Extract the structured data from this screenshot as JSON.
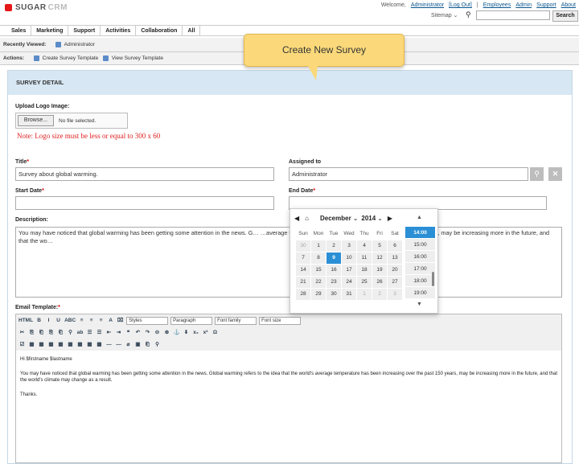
{
  "header": {
    "logo_main": "SUGAR",
    "logo_suffix": "CRM",
    "welcome": "Welcome,",
    "user": "Administrator",
    "logout": "[Log Out]",
    "links": [
      "Employees",
      "Admin",
      "Support",
      "About"
    ],
    "sitemap": "Sitemap ⌄",
    "search_button": "Search"
  },
  "nav": {
    "tabs": [
      "Sales",
      "Marketing",
      "Support",
      "Activities",
      "Collaboration",
      "All"
    ]
  },
  "recent": {
    "label": "Recently Viewed:",
    "item": "Administrator"
  },
  "actions": {
    "label": "Actions:",
    "items": [
      "Create Survey Template",
      "View Survey Template"
    ]
  },
  "tooltip": {
    "text": "Create New Survey"
  },
  "form": {
    "panel_title": "SURVEY DETAIL",
    "upload_label": "Upload Logo Image:",
    "browse": "Browse...",
    "no_file": "No file selected.",
    "note": "Note: Logo size must be less or equal to 300 x 60",
    "title_label": "Title",
    "title_value": "Survey about global warming.",
    "assigned_label": "Assigned to",
    "assigned_value": "Administrator",
    "start_label": "Start Date",
    "end_label": "End Date",
    "desc_label": "Description:",
    "desc_value": "You may have noticed that global warming has been getting some attention in the news. G… …average temperature has been increasing over the past 150 years, may be increasing more in the future, and that the wo…",
    "email_label": "Email Template:"
  },
  "editor": {
    "row1": [
      "HTML",
      "B",
      "I",
      "U",
      "ABC",
      "≡",
      "≡",
      "≡",
      "A",
      "⌧"
    ],
    "styles": "Styles",
    "paragraph": "Paragraph",
    "font_family": "Font family",
    "font_size": "Font size",
    "row2": [
      "✂",
      "⎘",
      "⎗",
      "⎘",
      "⎗",
      "⚲",
      "ab",
      "☰",
      "☰",
      "⇤",
      "⇥",
      "❝",
      "↶",
      "↷",
      "⊝",
      "⊕",
      "⚓",
      "⬇",
      "x₂",
      "x²",
      "Ω"
    ],
    "row3": [
      "☑",
      "▦",
      "▦",
      "▦",
      "▦",
      "▦",
      "▦",
      "▦",
      "▦",
      "—",
      "—",
      "⌀",
      "▣",
      "⎗",
      "⚲"
    ],
    "greeting": "Hi $firstname $lastname",
    "body": "You may have noticed that global warming has been getting some attention in the news. Global warming refers to the idea that the world's average temperature has been increasing over the past 150 years, may be increasing more in the future, and that the world's climate may change as a result.",
    "closing": "Thanks."
  },
  "calendar": {
    "month": "December",
    "year": "2014",
    "weekdays": [
      "Sun",
      "Mon",
      "Tue",
      "Wed",
      "Thu",
      "Fri",
      "Sat"
    ],
    "weeks": [
      [
        "30",
        "1",
        "2",
        "3",
        "4",
        "5",
        "6"
      ],
      [
        "7",
        "8",
        "9",
        "10",
        "11",
        "12",
        "13"
      ],
      [
        "14",
        "15",
        "16",
        "17",
        "18",
        "19",
        "20"
      ],
      [
        "21",
        "22",
        "23",
        "24",
        "25",
        "26",
        "27"
      ],
      [
        "28",
        "29",
        "30",
        "31",
        "1",
        "2",
        "3"
      ]
    ],
    "selected_day": "9",
    "times": [
      "14:00",
      "15:00",
      "16:00",
      "17:00",
      "18:00",
      "19:00"
    ],
    "selected_time": "14:00"
  }
}
